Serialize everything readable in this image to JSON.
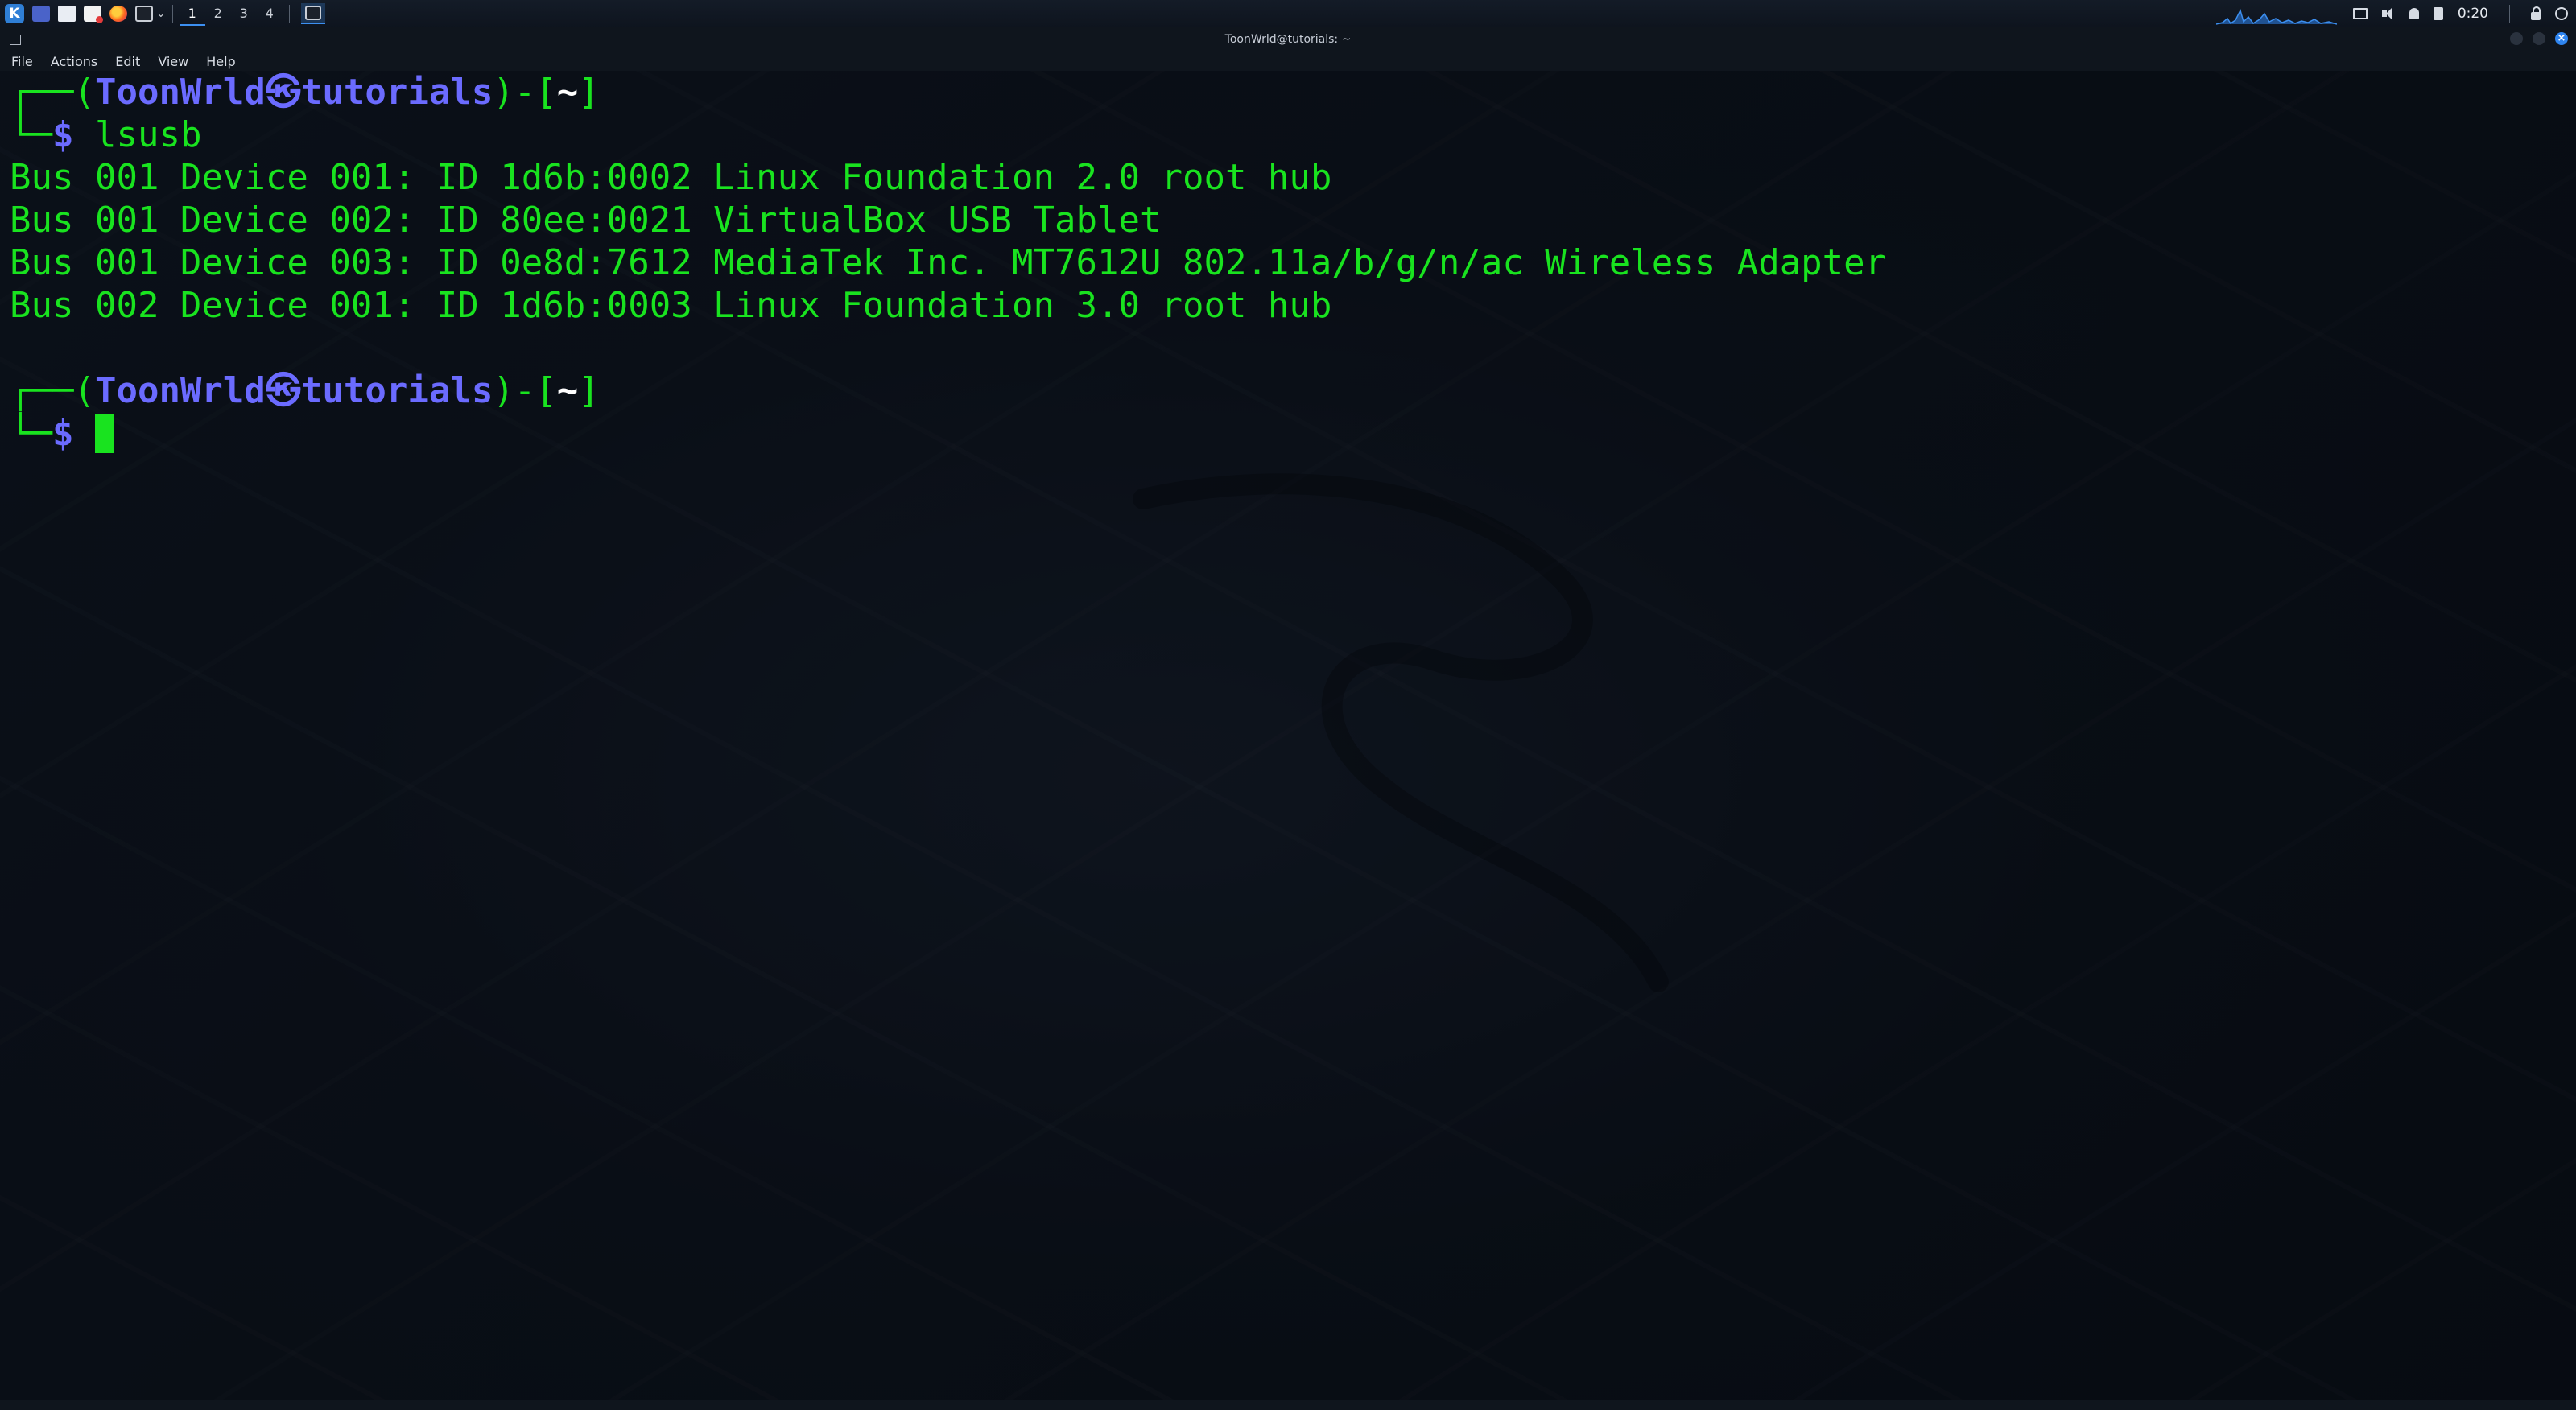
{
  "panel": {
    "workspaces": [
      "1",
      "2",
      "3",
      "4"
    ],
    "active_workspace": "1",
    "clock": "0:20",
    "icons": [
      "kali-menu-icon",
      "desktop-icon",
      "file-manager-icon",
      "text-editor-icon",
      "firefox-icon",
      "terminal-icon",
      "display-icon",
      "volume-icon",
      "notification-icon",
      "battery-icon",
      "lock-icon",
      "power-icon"
    ]
  },
  "window": {
    "title": "ToonWrld@tutorials: ~"
  },
  "menu": {
    "file": "File",
    "actions": "Actions",
    "edit": "Edit",
    "view": "View",
    "help": "Help"
  },
  "terminal": {
    "prompt": {
      "corner_top": "┌──(",
      "user": "ToonWrld",
      "symbol": "㉿",
      "host": "tutorials",
      "sep": ")-[",
      "path": "~",
      "close": "]",
      "corner_bottom": "└─",
      "dollar": "$"
    },
    "command": "lsusb",
    "output": [
      "Bus 001 Device 001: ID 1d6b:0002 Linux Foundation 2.0 root hub",
      "Bus 001 Device 002: ID 80ee:0021 VirtualBox USB Tablet",
      "Bus 001 Device 003: ID 0e8d:7612 MediaTek Inc. MT7612U 802.11a/b/g/n/ac Wireless Adapter",
      "Bus 002 Device 001: ID 1d6b:0003 Linux Foundation 3.0 root hub"
    ]
  },
  "colors": {
    "prompt_green": "#19e31f",
    "prompt_blue": "#6b6bff",
    "accent_blue": "#3c8ff0"
  }
}
